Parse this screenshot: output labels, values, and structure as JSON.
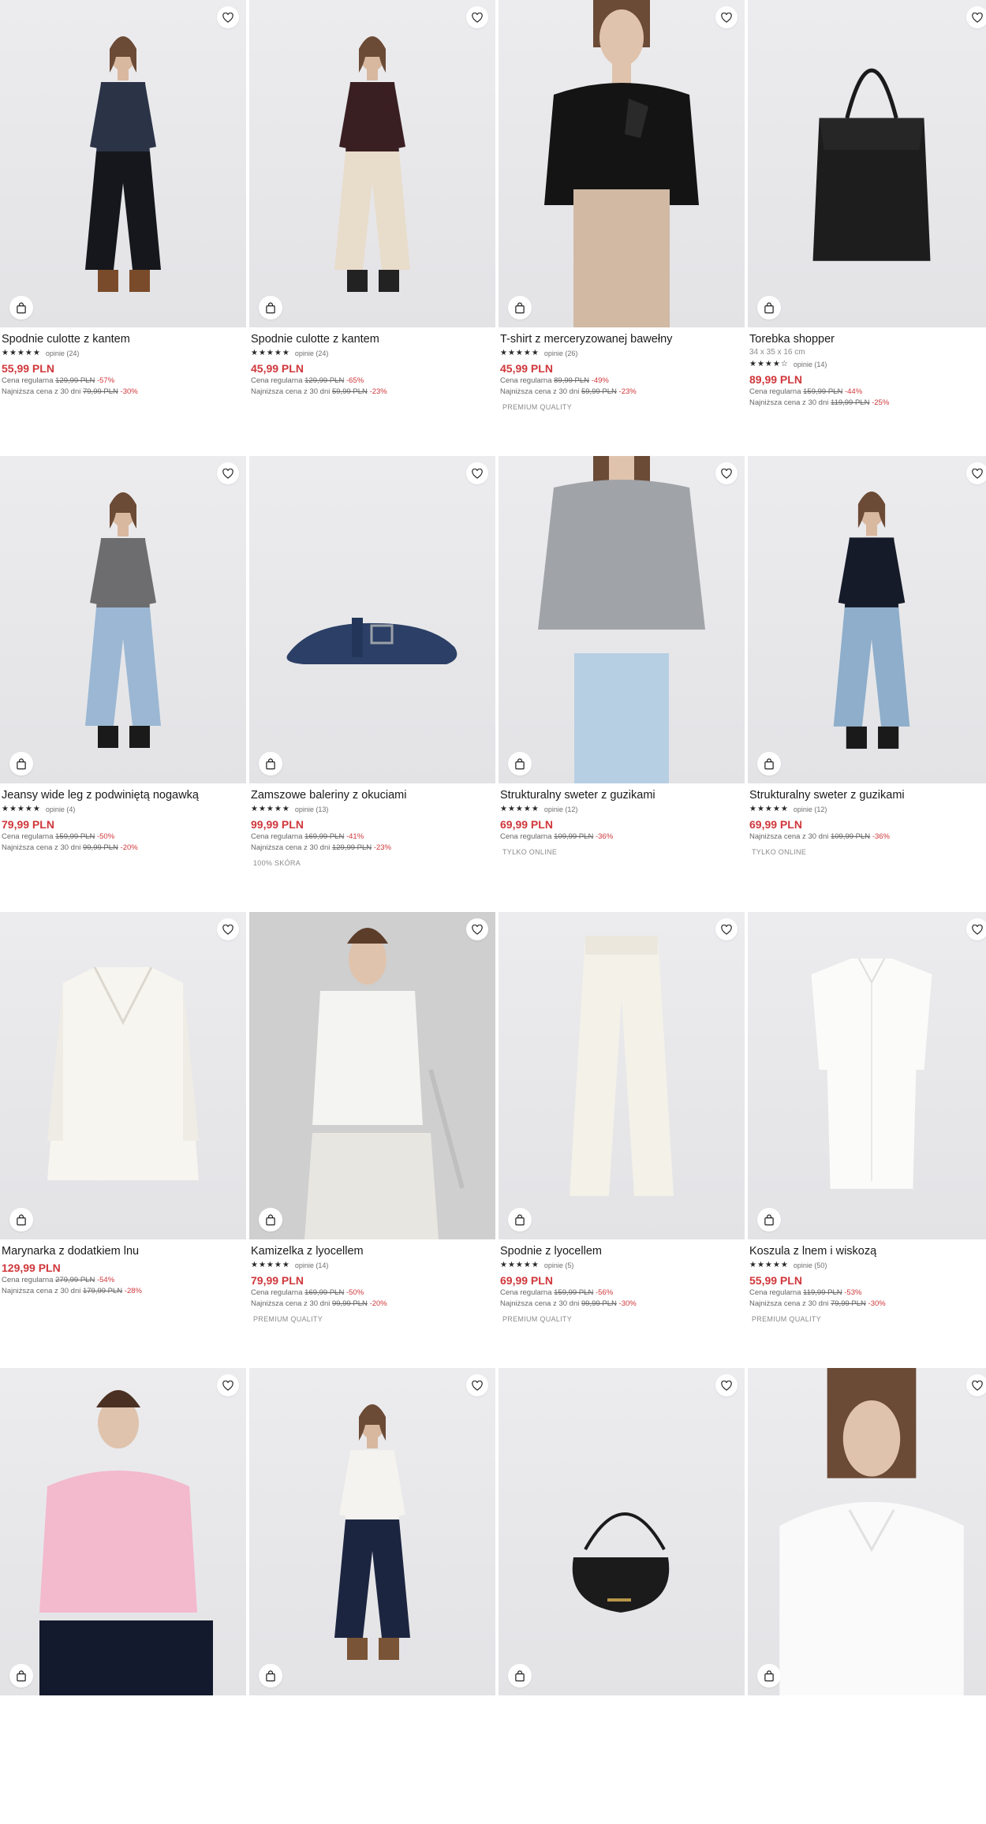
{
  "colors": {
    "accent": "#d0373b",
    "text": "#1a1a1a",
    "muted": "#666666"
  },
  "labels": {
    "regular": "Cena regularna",
    "lowest": "Najniższa cena z 30 dni",
    "reviews_prefix": "opinie"
  },
  "products": [
    {
      "name": "Spodnie culotte z kantem",
      "sub": "",
      "stars": 5,
      "reviews": "opinie (24)",
      "price": "55,99 PLN",
      "regular_price": "129,99 PLN",
      "regular_disc": "-57%",
      "lowest_price": "79,99 PLN",
      "lowest_disc": "-30%",
      "badge": "",
      "art": "model-culotte-navy"
    },
    {
      "name": "Spodnie culotte z kantem",
      "sub": "",
      "stars": 5,
      "reviews": "opinie (24)",
      "price": "45,99 PLN",
      "regular_price": "129,99 PLN",
      "regular_disc": "-65%",
      "lowest_price": "59,99 PLN",
      "lowest_disc": "-23%",
      "badge": "",
      "art": "model-culotte-beige"
    },
    {
      "name": "T-shirt z merceryzowanej bawełny",
      "sub": "",
      "stars": 5,
      "reviews": "opinie (26)",
      "price": "45,99 PLN",
      "regular_price": "89,99 PLN",
      "regular_disc": "-49%",
      "lowest_price": "59,99 PLN",
      "lowest_disc": "-23%",
      "badge": "PREMIUM QUALITY",
      "art": "model-tshirt-black"
    },
    {
      "name": "Torebka shopper",
      "sub": "34 x 35 x 16 cm",
      "stars": 4,
      "reviews": "opinie (14)",
      "price": "89,99 PLN",
      "regular_price": "159,99 PLN",
      "regular_disc": "-44%",
      "lowest_price": "119,99 PLN",
      "lowest_disc": "-25%",
      "badge": "",
      "art": "bag-shopper"
    },
    {
      "name": "Jeansy wide leg z podwiniętą nogawką",
      "sub": "",
      "stars": 5,
      "reviews": "opinie (4)",
      "price": "79,99 PLN",
      "regular_price": "159,99 PLN",
      "regular_disc": "-50%",
      "lowest_price": "99,99 PLN",
      "lowest_disc": "-20%",
      "badge": "",
      "art": "model-jeans"
    },
    {
      "name": "Zamszowe baleriny z okuciami",
      "sub": "",
      "stars": 5,
      "reviews": "opinie (13)",
      "price": "99,99 PLN",
      "regular_price": "169,99 PLN",
      "regular_disc": "-41%",
      "lowest_price": "129,99 PLN",
      "lowest_disc": "-23%",
      "badge": "100% SKÓRA",
      "art": "shoe-ballerina"
    },
    {
      "name": "Strukturalny sweter z guzikami",
      "sub": "",
      "stars": 5,
      "reviews": "opinie (12)",
      "price": "69,99 PLN",
      "regular_price": "109,99 PLN",
      "regular_disc": "-36%",
      "lowest_price": "",
      "lowest_disc": "",
      "badge": "TYLKO ONLINE",
      "art": "model-sweater-grey"
    },
    {
      "name": "Strukturalny sweter z guzikami",
      "sub": "",
      "stars": 5,
      "reviews": "opinie (12)",
      "price": "69,99 PLN",
      "regular_price": "",
      "regular_disc": "",
      "lowest_price": "109,99 PLN",
      "lowest_disc": "-36%",
      "badge": "TYLKO ONLINE",
      "art": "model-sweater-navy"
    },
    {
      "name": "Marynarka z dodatkiem lnu",
      "sub": "",
      "stars": 0,
      "reviews": "",
      "price": "129,99 PLN",
      "regular_price": "279,99 PLN",
      "regular_disc": "-54%",
      "lowest_price": "179,99 PLN",
      "lowest_disc": "-28%",
      "badge": "",
      "art": "blazer-white"
    },
    {
      "name": "Kamizelka z lyocellem",
      "sub": "",
      "stars": 4.5,
      "reviews": "opinie (14)",
      "price": "79,99 PLN",
      "regular_price": "169,99 PLN",
      "regular_disc": "-50%",
      "lowest_price": "99,99 PLN",
      "lowest_disc": "-20%",
      "badge": "PREMIUM QUALITY",
      "art": "model-vest-white"
    },
    {
      "name": "Spodnie z lyocellem",
      "sub": "",
      "stars": 5,
      "reviews": "opinie (5)",
      "price": "69,99 PLN",
      "regular_price": "159,99 PLN",
      "regular_disc": "-56%",
      "lowest_price": "99,99 PLN",
      "lowest_disc": "-30%",
      "badge": "PREMIUM QUALITY",
      "art": "trousers-white"
    },
    {
      "name": "Koszula z lnem i wiskozą",
      "sub": "",
      "stars": 4.5,
      "reviews": "opinie (50)",
      "price": "55,99 PLN",
      "regular_price": "119,99 PLN",
      "regular_disc": "-53%",
      "lowest_price": "79,99 PLN",
      "lowest_disc": "-30%",
      "badge": "PREMIUM QUALITY",
      "art": "shirt-white-flat"
    },
    {
      "name": "",
      "sub": "",
      "stars": 0,
      "reviews": "",
      "price": "",
      "regular_price": "",
      "regular_disc": "",
      "lowest_price": "",
      "lowest_disc": "",
      "badge": "",
      "art": "model-pink-shirt"
    },
    {
      "name": "",
      "sub": "",
      "stars": 0,
      "reviews": "",
      "price": "",
      "regular_price": "",
      "regular_disc": "",
      "lowest_price": "",
      "lowest_disc": "",
      "badge": "",
      "art": "model-white-blouse"
    },
    {
      "name": "",
      "sub": "",
      "stars": 0,
      "reviews": "",
      "price": "",
      "regular_price": "",
      "regular_disc": "",
      "lowest_price": "",
      "lowest_disc": "",
      "badge": "",
      "art": "bag-crossbody-black"
    },
    {
      "name": "",
      "sub": "",
      "stars": 0,
      "reviews": "",
      "price": "",
      "regular_price": "",
      "regular_disc": "",
      "lowest_price": "",
      "lowest_disc": "",
      "badge": "",
      "art": "model-white-shirt"
    }
  ]
}
